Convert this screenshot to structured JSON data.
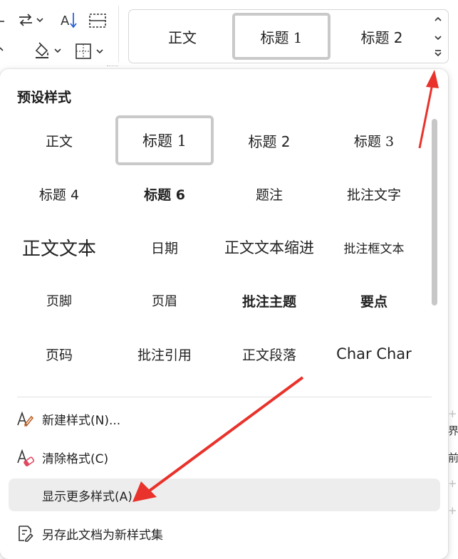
{
  "ribbon": {
    "gallery": {
      "items": [
        {
          "label": "正文",
          "selected": false
        },
        {
          "label": "标题  1",
          "selected": true
        },
        {
          "label": "标题 2",
          "selected": false
        }
      ]
    },
    "tools": {
      "sort_icon_letters": "A",
      "dropdown_glyph": "⌄"
    }
  },
  "panel": {
    "title": "预设样式",
    "styles": [
      {
        "label": "正文",
        "font": "serif",
        "size": 19,
        "weight": "normal",
        "selected": false
      },
      {
        "label": "标题  1",
        "font": "serif",
        "size": 21,
        "weight": "normal",
        "selected": true
      },
      {
        "label": "标题 2",
        "font": "sans",
        "size": 20,
        "weight": "normal",
        "selected": false
      },
      {
        "label": "标题  3",
        "font": "serif",
        "size": 19,
        "weight": "normal",
        "selected": false
      },
      {
        "label": "标题 4",
        "font": "sans",
        "size": 19,
        "weight": "normal",
        "selected": false
      },
      {
        "label": "标题 6",
        "font": "sans",
        "size": 19,
        "weight": "bold",
        "selected": false
      },
      {
        "label": "题注",
        "font": "serif",
        "size": 19,
        "weight": "normal",
        "selected": false
      },
      {
        "label": "批注文字",
        "font": "serif",
        "size": 19,
        "weight": "normal",
        "selected": false
      },
      {
        "label": "正文文本",
        "font": "sans",
        "size": 26,
        "weight": "normal",
        "selected": false
      },
      {
        "label": "日期",
        "font": "serif",
        "size": 19,
        "weight": "normal",
        "selected": false
      },
      {
        "label": "正文文本缩进",
        "font": "serif",
        "size": 21,
        "weight": "normal",
        "selected": false
      },
      {
        "label": "批注框文本",
        "font": "serif",
        "size": 17,
        "weight": "normal",
        "selected": false
      },
      {
        "label": "页脚",
        "font": "serif",
        "size": 18,
        "weight": "normal",
        "selected": false
      },
      {
        "label": "页眉",
        "font": "serif",
        "size": 18,
        "weight": "normal",
        "selected": false
      },
      {
        "label": "批注主题",
        "font": "serif",
        "size": 19,
        "weight": "bold",
        "selected": false
      },
      {
        "label": "要点",
        "font": "serif",
        "size": 19,
        "weight": "bold",
        "selected": false
      },
      {
        "label": "页码",
        "font": "serif",
        "size": 19,
        "weight": "normal",
        "selected": false
      },
      {
        "label": "批注引用",
        "font": "serif",
        "size": 19,
        "weight": "normal",
        "selected": false
      },
      {
        "label": "正文段落",
        "font": "serif",
        "size": 19,
        "weight": "normal",
        "selected": false
      },
      {
        "label": "Char Char",
        "font": "sans",
        "size": 21,
        "weight": "normal",
        "selected": false
      }
    ],
    "menu": [
      {
        "label": "新建样式(N)...",
        "icon": "new-style-icon",
        "hover": false
      },
      {
        "label": "清除格式(C)",
        "icon": "clear-format-icon",
        "hover": false
      },
      {
        "label": "显示更多样式(A)",
        "icon": "",
        "hover": true
      },
      {
        "label": "另存此文档为新样式集",
        "icon": "save-style-set-icon",
        "hover": false
      }
    ]
  },
  "background_doc": {
    "chars": [
      "+",
      "界",
      "前",
      "+",
      "+"
    ]
  },
  "colors": {
    "accent_red": "#e8322b",
    "selected_border": "#c9c9c9",
    "hover_bg": "#ededed",
    "icon_orange": "#c0642a",
    "icon_pink": "#e04860",
    "sort_blue": "#2b62d9"
  }
}
